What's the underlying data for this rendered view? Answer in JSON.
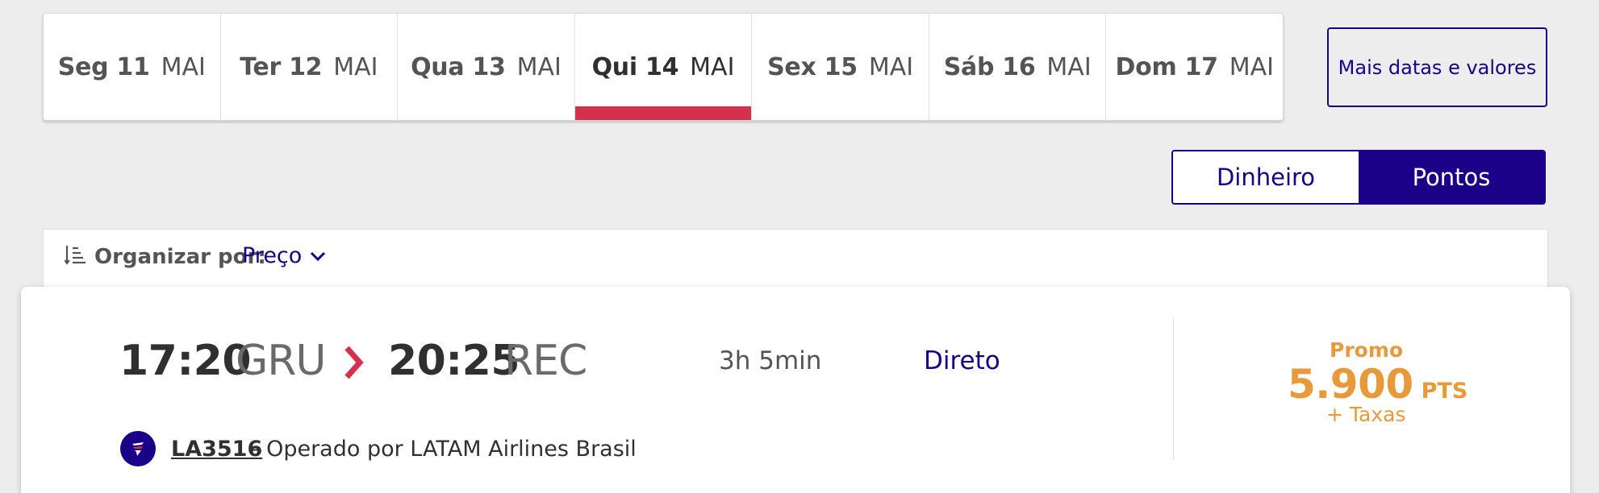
{
  "date_tabs": [
    {
      "day": "Seg 11",
      "month": "MAI",
      "active": false
    },
    {
      "day": "Ter 12",
      "month": "MAI",
      "active": false
    },
    {
      "day": "Qua 13",
      "month": "MAI",
      "active": false
    },
    {
      "day": "Qui 14",
      "month": "MAI",
      "active": true
    },
    {
      "day": "Sex 15",
      "month": "MAI",
      "active": false
    },
    {
      "day": "Sáb 16",
      "month": "MAI",
      "active": false
    },
    {
      "day": "Dom 17",
      "month": "MAI",
      "active": false
    }
  ],
  "more_dates_label": "Mais datas e valores",
  "currency_toggle": {
    "options": [
      "Dinheiro",
      "Pontos"
    ],
    "selected": "Pontos"
  },
  "sort": {
    "label": "Organizar por:",
    "value": "Preço"
  },
  "flight": {
    "departure_time": "17:20",
    "departure_airport": "GRU",
    "arrival_time": "20:25",
    "arrival_airport": "REC",
    "duration": "3h 5min",
    "stops": "Direto",
    "fare_label": "Promo",
    "fare_amount": "5.900",
    "fare_unit": "PTS",
    "fare_taxes": "+ Taxas",
    "flight_number": "LA3516",
    "operated_by": "– Operado por LATAM Airlines Brasil"
  },
  "colors": {
    "brand_indigo": "#1b0088",
    "active_tab_red": "#d6304f",
    "fare_orange": "#e8993a",
    "background": "#ededed"
  },
  "icons": [
    "sort-icon",
    "chevron-down-icon",
    "chevron-right-icon",
    "latam-logo-icon"
  ]
}
